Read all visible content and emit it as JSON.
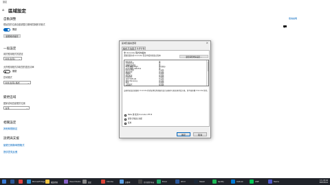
{
  "window": {
    "title": "設定"
  },
  "page": {
    "title": "區域設定"
  },
  "help": {
    "link": "取得說明"
  },
  "sections": {
    "auto": {
      "title": "自動調整",
      "desc": "根據您的位置自動調整日期時間與數字格式",
      "toggle_label": "開啟",
      "button": "變更格式設定"
    },
    "general": {
      "title": "一般設定",
      "lang_label": "用於應用程式的語言",
      "lang_value": "中文(台灣)",
      "toggle_desc": "允許應用程式存取您的語言清單",
      "toggle_label": "關閉",
      "format_label": "區域格式",
      "format_value": "中文(台灣) 格式"
    },
    "region": {
      "title": "變更區域",
      "label": "國家或地區變更的位置",
      "value": "台灣"
    },
    "related": {
      "title": "相關設定",
      "link": "其他時間設定"
    },
    "support": {
      "title": "說明與支援",
      "link1": "變更日期與時間格式",
      "link2": "提供意見反應"
    }
  },
  "dialog": {
    "title": "區域及語言選項",
    "close": "×",
    "tabs": [
      "格式",
      "位置",
      "系統管理"
    ],
    "panel_label": "非 Unicode 程式的語言",
    "panel_desc": "選取您要在非 Unicode 程式中使用的語言版本",
    "advanced_button": "變更系統地區設定...",
    "codepages": [
      [
        "阿拉伯文",
        "是"
      ],
      [
        "亞美尼亞文",
        "是"
      ],
      [
        "波羅的海語系",
        "是"
      ],
      [
        "中文(繁體) Big5",
        "是(目前)"
      ],
      [
        "中文(簡體) GB2312",
        "是"
      ],
      [
        "斯拉夫語系",
        "已安裝"
      ],
      [
        "喬治亞文",
        "已安裝"
      ],
      [
        "希臘文",
        "已安裝"
      ],
      [
        "希伯來文",
        "已安裝"
      ],
      [
        "印度語系",
        "已安裝"
      ],
      [
        "日文 Shift-JIS",
        "已安裝"
      ],
      [
        "韓文 Wansung",
        "已安裝"
      ],
      [
        "泰文",
        "已安裝"
      ],
      [
        "土耳其文",
        "已安裝"
      ],
      [
        "越南文",
        "已安裝"
      ]
    ],
    "note": "這個系統設定會讓非 Unicode 程式使用您所選取的語言來顯示功能表與對話方塊，並不會影響 Unicode 程式。",
    "checkbox1": "Beta 版:使用 Unicode UTF-8",
    "checkbox2": "提供全球語言支援",
    "checkbox3": "套用",
    "ok": "確定",
    "cancel": "取消"
  },
  "taskbar": {
    "items": [
      {
        "label": "",
        "color": "#3a7bd5"
      },
      {
        "label": "",
        "color": "#2b5797"
      },
      {
        "label": "",
        "color": "#e04343"
      },
      {
        "label": "Microsoft Edge",
        "color": "#2d8fd5"
      },
      {
        "label": "檔案總管",
        "color": "#f4c542"
      },
      {
        "label": "Visual Studio",
        "color": "#8661c5"
      },
      {
        "label": "設定",
        "color": "#888888"
      },
      {
        "label": "Chrome",
        "color": "#db4437"
      },
      {
        "label": "記事本",
        "color": "#5aa0e6"
      },
      {
        "label": "命令提示字元",
        "color": "#444444"
      },
      {
        "label": "Excel",
        "color": "#21a366"
      },
      {
        "label": "Word",
        "color": "#2b579a"
      },
      {
        "label": "Steam",
        "color": "#1b2838"
      },
      {
        "label": "Spotify",
        "color": "#1db954"
      },
      {
        "label": "Outlook",
        "color": "#0078d4"
      },
      {
        "label": "LINE",
        "color": "#06c755"
      },
      {
        "label": "Teams",
        "color": "#5059c9"
      }
    ],
    "time": "下午 03:42",
    "date": "2023/5/12"
  }
}
